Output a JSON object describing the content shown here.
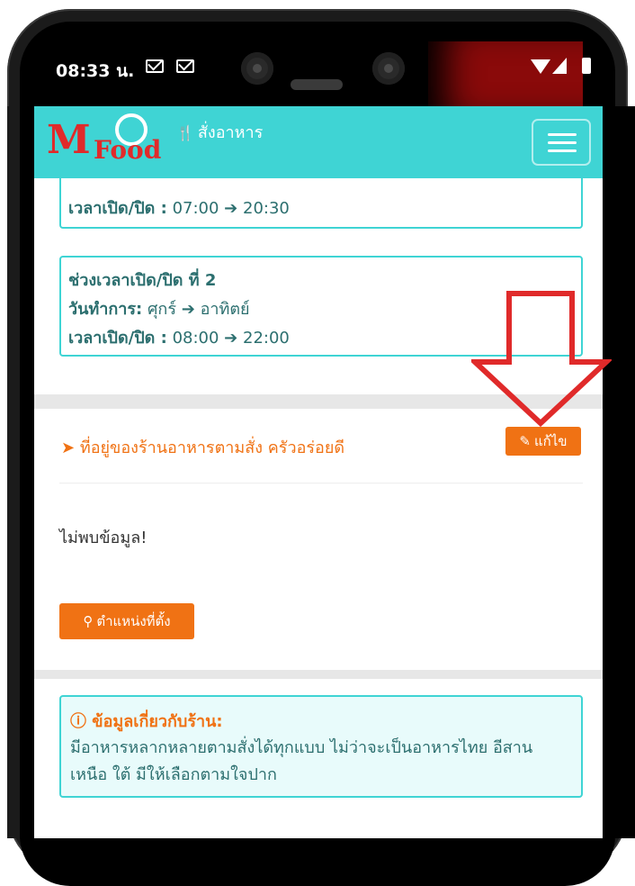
{
  "status_bar": {
    "time": "08:33 น."
  },
  "navbar": {
    "brand_m": "M",
    "brand_food": "Food",
    "brand_text": "สั่งอาหาร"
  },
  "hours_card_1": {
    "time_label": "เวลาเปิด/ปิด :",
    "open": "07:00",
    "close": "20:30"
  },
  "hours_card_2": {
    "title": "ช่วงเวลาเปิด/ปิด ที่ 2",
    "days_label": "วันทำการ:",
    "day_from": "ศุกร์",
    "day_to": "อาทิตย์",
    "time_label": "เวลาเปิด/ปิด :",
    "open": "08:00",
    "close": "22:00"
  },
  "address_section": {
    "title": "ที่อยู่ของร้านอาหารตามสั่ง ครัวอร่อยดี",
    "edit_label": "แก้ไข",
    "no_data": "ไม่พบข้อมูล!",
    "location_label": "ตำแหน่งที่ตั้ง"
  },
  "about_section": {
    "title": "ข้อมูลเกี่ยวกับร้าน:",
    "text": "มีอาหารหลากหลายตามสั่งได้ทุกแบบ ไม่ว่าจะเป็นอาหารไทย อีสาน เหนือ ใต้ มีให้เลือกตามใจปาก"
  },
  "colors": {
    "accent": "#3fd4d4",
    "orange": "#f07214",
    "arrow": "#e02a2a"
  }
}
